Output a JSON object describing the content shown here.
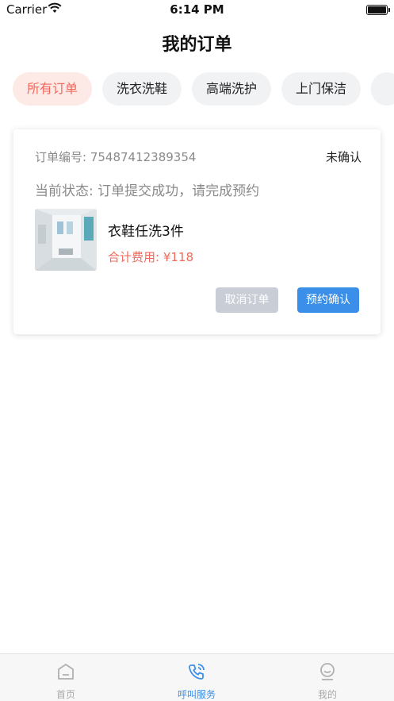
{
  "status_bar": {
    "carrier": "Carrier",
    "time": "6:14 PM"
  },
  "nav": {
    "title": "我的订单"
  },
  "tabs": [
    {
      "label": "所有订单",
      "active": true
    },
    {
      "label": "洗衣洗鞋",
      "active": false
    },
    {
      "label": "高端洗护",
      "active": false
    },
    {
      "label": "上门保洁",
      "active": false
    }
  ],
  "order": {
    "order_no": "订单编号: 75487412389354",
    "state": "未确认",
    "current_status": "当前状态: 订单提交成功，请完成预约",
    "item_name": "衣鞋任洗3件",
    "total": "合计费用: ¥118",
    "cancel_label": "取消订单",
    "confirm_label": "预约确认"
  },
  "tabbar": {
    "home": "首页",
    "call": "呼叫服务",
    "mine": "我的",
    "active": "call"
  },
  "colors": {
    "accent": "#3b8fe8",
    "highlight": "#f2685b",
    "active_tab_bg": "#fde9e6"
  }
}
